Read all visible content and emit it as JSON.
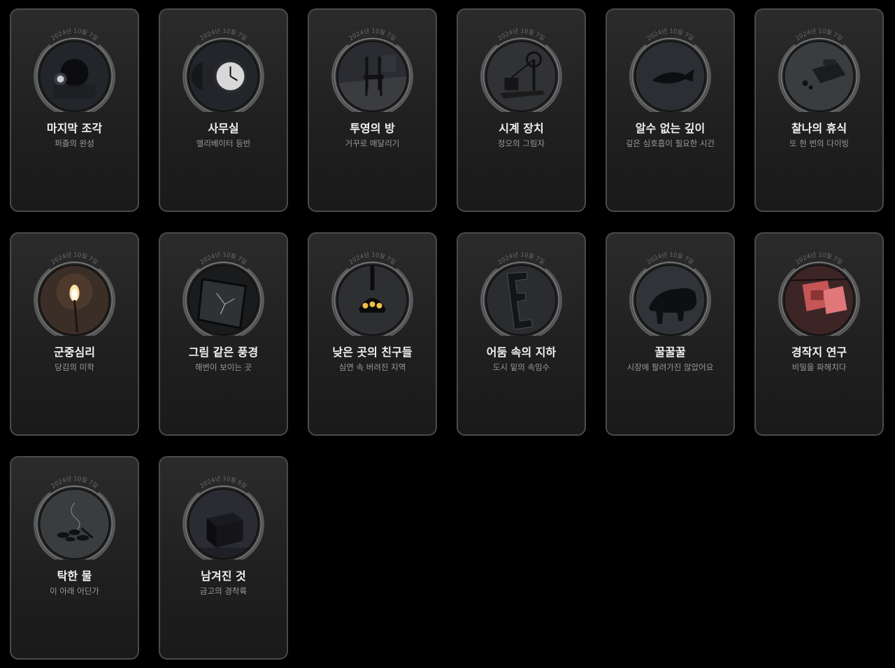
{
  "achievements": [
    {
      "date": "2024년 10월 7일",
      "title": "마지막 조각",
      "subtitle": "퍼즐의 완성",
      "icon": "robot-head-icon"
    },
    {
      "date": "2024년 10월 7일",
      "title": "사무실",
      "subtitle": "엘리베이터 등반",
      "icon": "wall-clock-icon"
    },
    {
      "date": "2024년 10월 7일",
      "title": "투영의 방",
      "subtitle": "거꾸로 매달리기",
      "icon": "chair-icon"
    },
    {
      "date": "2024년 10월 7일",
      "title": "시계 장치",
      "subtitle": "정오의 그림자",
      "icon": "crank-machine-icon"
    },
    {
      "date": "2024년 10월 7일",
      "title": "알수 없는 깊이",
      "subtitle": "깊은 심호흡이 필요한 시간",
      "icon": "fish-icon"
    },
    {
      "date": "2024년 10월 7일",
      "title": "찰나의 휴식",
      "subtitle": "또 한 번의 다이빙",
      "icon": "control-box-icon"
    },
    {
      "date": "2024년 10월 7일",
      "title": "군중심리",
      "subtitle": "당김의 미학",
      "icon": "torch-icon"
    },
    {
      "date": "2024년 10월 7일",
      "title": "그림 같은 풍경",
      "subtitle": "해변이 보이는 곳",
      "icon": "broken-frame-icon"
    },
    {
      "date": "2024년 10월 7일",
      "title": "낮은 곳의 친구들",
      "subtitle": "심연 속 버려진 지역",
      "icon": "lantern-icon"
    },
    {
      "date": "2024년 10월 7일",
      "title": "어둠 속의 지하",
      "subtitle": "도시 밑의 속임수",
      "icon": "letter-e-icon"
    },
    {
      "date": "2024년 10월 7일",
      "title": "꿀꿀꿀",
      "subtitle": "시장에 팔려가진 않았어요",
      "icon": "pig-icon"
    },
    {
      "date": "2024년 10월 7일",
      "title": "경작지 연구",
      "subtitle": "비밀을 파헤치다",
      "icon": "red-papers-icon"
    },
    {
      "date": "2024년 10월 7일",
      "title": "탁한 물",
      "subtitle": "이 아래 어딘가",
      "icon": "burnt-debris-icon"
    },
    {
      "date": "2024년 10월 6일",
      "title": "남겨진 것",
      "subtitle": "금고의 경착륙",
      "icon": "safe-box-icon"
    }
  ]
}
